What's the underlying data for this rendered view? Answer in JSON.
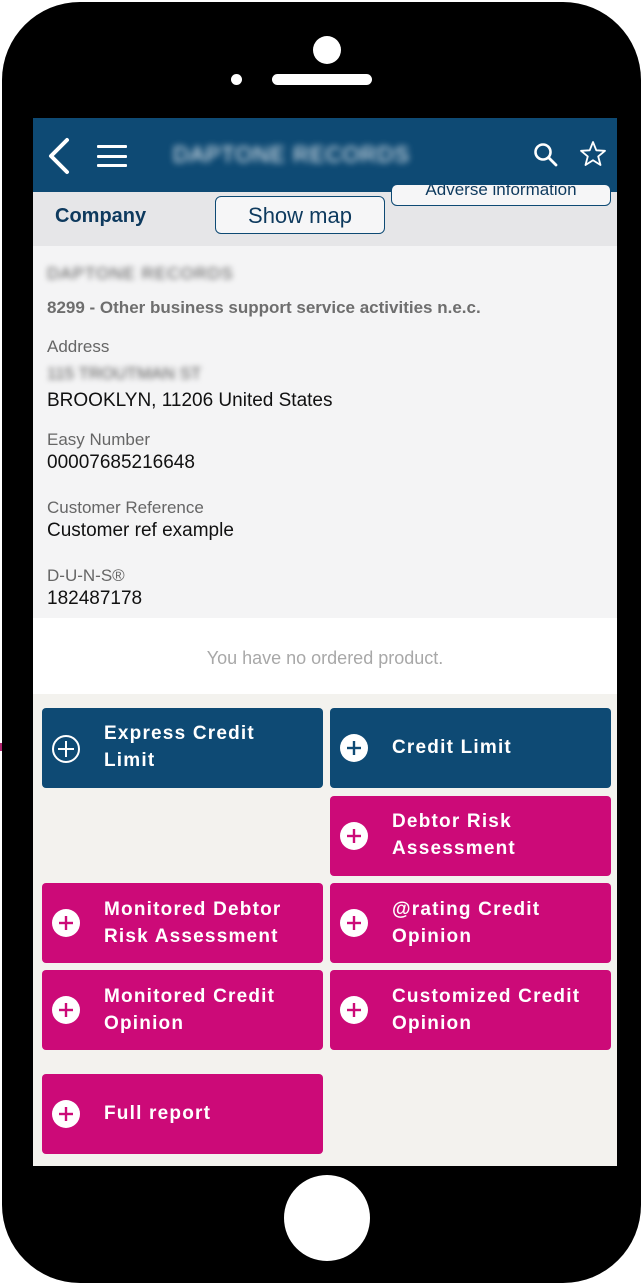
{
  "header": {
    "company_name": "DAPTONE RECORDS",
    "back_icon": "chevron-left-icon",
    "menu_icon": "hamburger-menu-icon",
    "search_icon": "search-icon",
    "favorite_icon": "star-outline-icon"
  },
  "tabs": {
    "company": "Company",
    "show_map": "Show map",
    "adverse_information": "Adverse information"
  },
  "company": {
    "name": "DAPTONE RECORDS",
    "activity": "8299 - Other business support service activities n.e.c.",
    "address_label": "Address",
    "address_line1": "115 TROUTMAN ST",
    "address_line2": "BROOKLYN, 11206 United States",
    "easy_number_label": "Easy Number",
    "easy_number": "00007685216648",
    "customer_reference_label": "Customer Reference",
    "customer_reference": "Customer ref example",
    "duns_label": "D-U-N-S®",
    "duns": "182487178"
  },
  "no_product_message": "You have no ordered product.",
  "products": {
    "express_credit_limit": [
      "Express Credit",
      "Limit"
    ],
    "credit_limit": [
      "Credit Limit"
    ],
    "debtor_risk_assessment": [
      "Debtor Risk",
      "Assessment"
    ],
    "monitored_debtor_risk_assessment": [
      "Monitored Debtor",
      "Risk Assessment"
    ],
    "rating_credit_opinion": [
      "@rating Credit",
      "Opinion"
    ],
    "monitored_credit_opinion": [
      "Monitored Credit",
      "Opinion"
    ],
    "customized_credit_opinion": [
      "Customized Credit",
      "Opinion"
    ],
    "full_report": [
      "Full report"
    ]
  },
  "colors": {
    "navy": "#0e4a74",
    "magenta": "#cc0a78",
    "arrow": "#b0256e"
  }
}
